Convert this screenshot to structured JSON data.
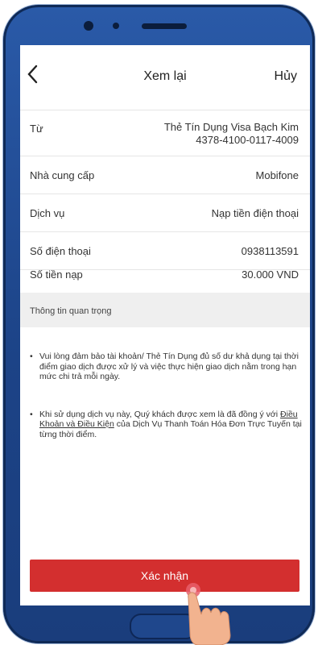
{
  "header": {
    "back_icon": "chevron-left-icon",
    "title": "Xem lại",
    "cancel": "Hủy"
  },
  "rows": [
    {
      "label": "Từ",
      "value_line1": "Thẻ Tín Dụng Visa Bạch Kim",
      "value_line2": "4378-4100-0117-4009"
    },
    {
      "label": "Nhà cung cấp",
      "value": "Mobifone"
    },
    {
      "label": "Dịch vụ",
      "value": "Nạp tiền điện thoại"
    },
    {
      "label": "Số điện thoại",
      "value": "0938113591"
    },
    {
      "label": "Số tiền nạp",
      "value": "30.000 VND"
    }
  ],
  "info": {
    "title": "Thông tin quan trọng",
    "bullet1": "Vui lòng đảm bảo tài khoản/ Thẻ Tín Dụng đủ số dư khả dụng tại thời điểm giao dịch được xử lý và việc thực hiện giao dịch nằm trong hạn mức chi trả mỗi ngày.",
    "bullet2_before": "Khi sử dụng dịch vụ này, Quý khách được xem là đã đồng ý với ",
    "bullet2_link": "Điều Khoản và Điều Kiện",
    "bullet2_after": " của Dịch Vụ Thanh Toán Hóa Đơn Trực Tuyến tại từng thời điểm."
  },
  "confirm_button": "Xác nhận",
  "colors": {
    "primary_red": "#d32f2f",
    "frame_blue": "#1c4387"
  }
}
